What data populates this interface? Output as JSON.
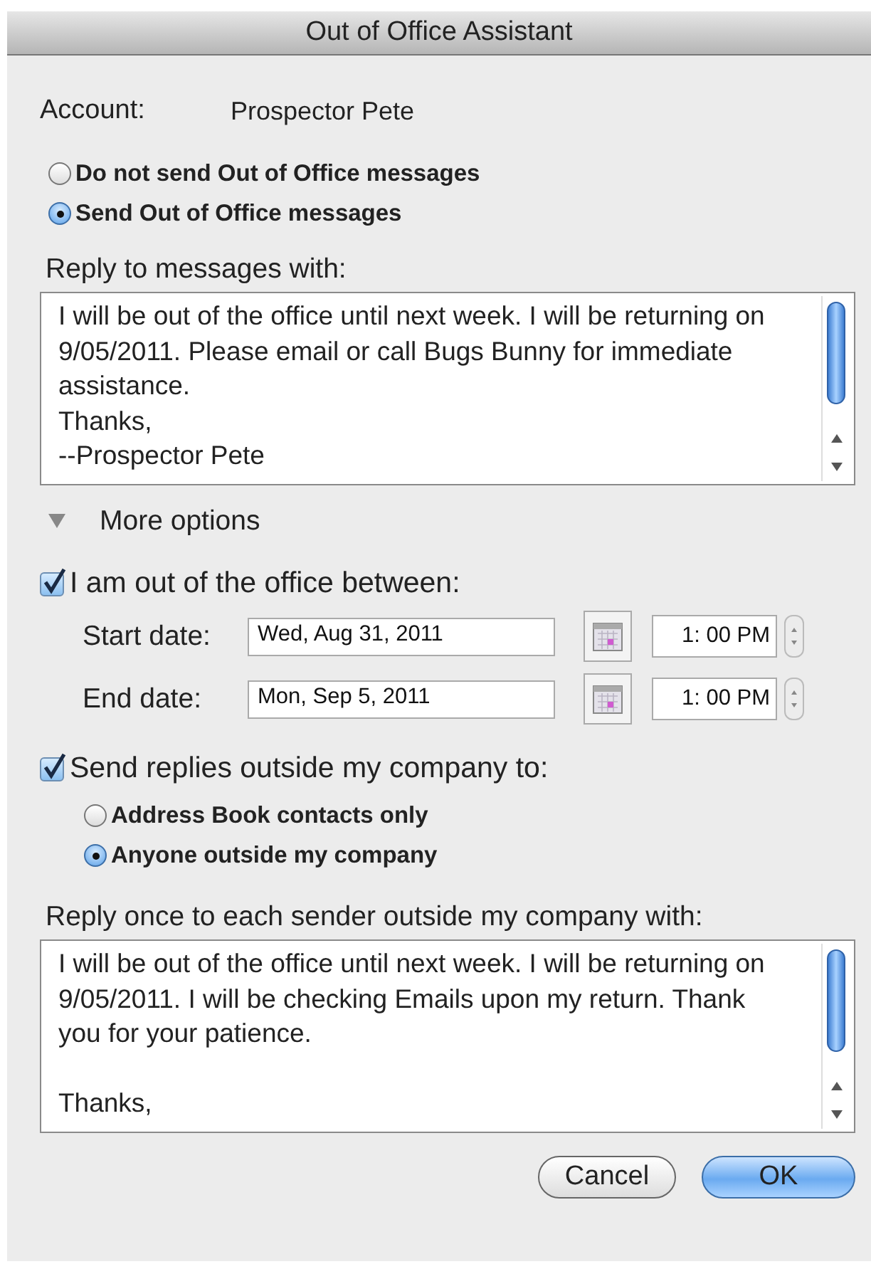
{
  "window": {
    "title": "Out of Office Assistant"
  },
  "account": {
    "label": "Account:",
    "value": "Prospector Pete"
  },
  "send_mode": [
    {
      "label": "Do not send Out of Office messages",
      "selected": false
    },
    {
      "label": "Send Out of Office messages",
      "selected": true
    }
  ],
  "reply": {
    "label": "Reply to messages with:",
    "lines": [
      "I will be out of the office until next week. I will be returning on",
      "9/05/2011. Please email or call Bugs Bunny for immediate",
      "assistance.",
      "Thanks,",
      "--Prospector Pete"
    ]
  },
  "more_options": {
    "label": "More options",
    "expanded": true
  },
  "out_of_office": {
    "label": "I am out of the office between:",
    "checked": true,
    "dates": [
      {
        "label": "Start date:",
        "date": "Wed, Aug 31, 2011",
        "time": "1: 00 PM"
      },
      {
        "label": "End date:",
        "date": "Mon, Sep 5, 2011",
        "time": "1: 00 PM"
      }
    ]
  },
  "external": {
    "label": "Send replies outside my company to:",
    "checked": true,
    "options": [
      {
        "label": "Address Book contacts only",
        "selected": false
      },
      {
        "label": "Anyone outside my company",
        "selected": true
      }
    ]
  },
  "external_reply": {
    "label": "Reply once to each sender outside my company with:",
    "lines": [
      "I will be out of the office until next week. I will be returning on",
      "9/05/2011. I will be checking Emails upon my return. Thank",
      "you for your patience."
    ],
    "closing": "Thanks,"
  },
  "buttons": [
    {
      "label": "Cancel",
      "kind": "cancel"
    },
    {
      "label": "OK",
      "kind": "default"
    }
  ]
}
